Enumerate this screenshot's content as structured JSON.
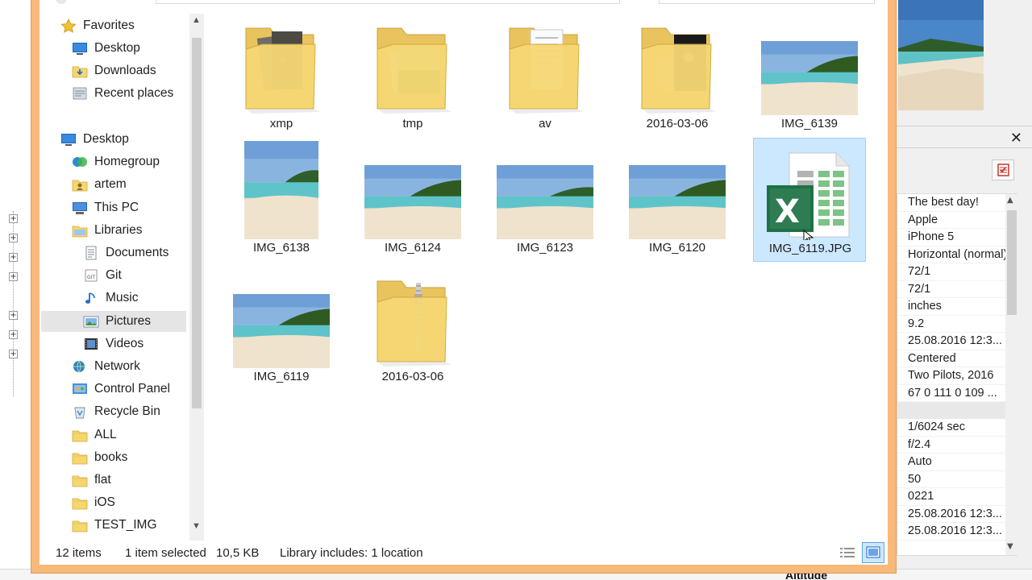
{
  "window": {
    "title": ""
  },
  "navigation": {
    "favorites": [
      {
        "label": "Favorites",
        "icon": "star-icon",
        "indent": 0
      },
      {
        "label": "Desktop",
        "icon": "desktop-icon",
        "indent": 1
      },
      {
        "label": "Downloads",
        "icon": "downloads-folder-icon",
        "indent": 1
      },
      {
        "label": "Recent places",
        "icon": "recent-places-icon",
        "indent": 1
      }
    ],
    "tree": [
      {
        "label": "Desktop",
        "icon": "desktop-icon"
      },
      {
        "label": "Homegroup",
        "icon": "homegroup-icon"
      },
      {
        "label": "artem",
        "icon": "user-folder-icon"
      },
      {
        "label": "This PC",
        "icon": "computer-icon"
      },
      {
        "label": "Libraries",
        "icon": "libraries-icon"
      },
      {
        "label": "Documents",
        "icon": "documents-icon"
      },
      {
        "label": "Git",
        "icon": "git-library-icon"
      },
      {
        "label": "Music",
        "icon": "music-icon"
      },
      {
        "label": "Pictures",
        "icon": "pictures-icon"
      },
      {
        "label": "Videos",
        "icon": "videos-icon"
      },
      {
        "label": "Network",
        "icon": "network-icon"
      },
      {
        "label": "Control Panel",
        "icon": "control-panel-icon"
      },
      {
        "label": "Recycle Bin",
        "icon": "recycle-bin-icon"
      },
      {
        "label": "ALL",
        "icon": "folder-icon"
      },
      {
        "label": "books",
        "icon": "folder-icon"
      },
      {
        "label": "flat",
        "icon": "folder-icon"
      },
      {
        "label": "iOS",
        "icon": "folder-icon"
      },
      {
        "label": "TEST_IMG",
        "icon": "folder-icon"
      }
    ],
    "selected": "Pictures"
  },
  "items": [
    {
      "name": "xmp",
      "kind": "folder-with-files",
      "selected": false
    },
    {
      "name": "tmp",
      "kind": "folder-with-photo",
      "selected": false
    },
    {
      "name": "av",
      "kind": "folder-with-pages",
      "selected": false
    },
    {
      "name": "2016-03-06",
      "kind": "folder-with-dark-photo",
      "selected": false
    },
    {
      "name": "IMG_6139",
      "kind": "beach-photo",
      "selected": false
    },
    {
      "name": "IMG_6138",
      "kind": "beach-photo-portrait",
      "selected": false
    },
    {
      "name": "IMG_6124",
      "kind": "beach-photo",
      "selected": false
    },
    {
      "name": "IMG_6123",
      "kind": "beach-photo",
      "selected": false
    },
    {
      "name": "IMG_6120",
      "kind": "beach-photo",
      "selected": false
    },
    {
      "name": "IMG_6119.JPG",
      "kind": "excel-file",
      "selected": true
    },
    {
      "name": "IMG_6119",
      "kind": "beach-photo",
      "selected": false
    },
    {
      "name": "2016-03-06",
      "kind": "zip-folder",
      "selected": false
    }
  ],
  "status": {
    "item_count": "12 items",
    "selection": "1 item selected",
    "size": "10,5 KB",
    "library": "Library includes: 1 location"
  },
  "properties": {
    "group1": [
      "The best day!",
      "Apple",
      "iPhone 5",
      "Horizontal (normal)",
      "72/1",
      "72/1",
      "inches",
      "9.2",
      "25.08.2016 12:3...",
      "Centered",
      "Two Pilots, 2016",
      "67 0 111 0 109 ..."
    ],
    "group2": [
      "1/6024 sec",
      "f/2.4",
      "Auto",
      "50",
      "0221",
      "25.08.2016 12:3...",
      "25.08.2016 12:3..."
    ],
    "bottom_label": "Altitude"
  },
  "colors": {
    "dialog_border": "#f9b97a",
    "selection_fill": "#cce8ff",
    "selection_border": "#99d1ff",
    "folder_yellow": "#f5d76e",
    "excel_green": "#1e7145"
  }
}
